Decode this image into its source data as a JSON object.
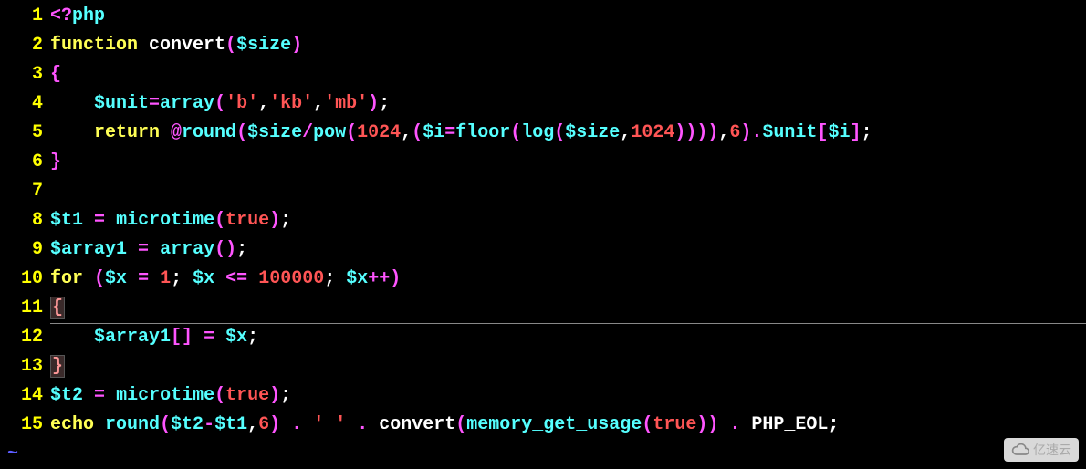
{
  "lines": [
    {
      "num": "1",
      "tokens": [
        [
          "<?",
          "op"
        ],
        [
          "php",
          "var"
        ]
      ]
    },
    {
      "num": "2",
      "tokens": [
        [
          "function ",
          "keyword"
        ],
        [
          "convert",
          "white"
        ],
        [
          "(",
          "paren"
        ],
        [
          "$size",
          "var"
        ],
        [
          ")",
          "paren"
        ]
      ]
    },
    {
      "num": "3",
      "tokens": [
        [
          "{",
          "brace"
        ]
      ]
    },
    {
      "num": "4",
      "tokens": [
        [
          "    ",
          "default"
        ],
        [
          "$unit",
          "var"
        ],
        [
          "=",
          "op"
        ],
        [
          "array",
          "func"
        ],
        [
          "(",
          "paren"
        ],
        [
          "'b'",
          "string"
        ],
        [
          ",",
          "white"
        ],
        [
          "'kb'",
          "string"
        ],
        [
          ",",
          "white"
        ],
        [
          "'mb'",
          "string"
        ],
        [
          ")",
          "paren"
        ],
        [
          ";",
          "white"
        ]
      ]
    },
    {
      "num": "5",
      "tokens": [
        [
          "    ",
          "default"
        ],
        [
          "return ",
          "keyword"
        ],
        [
          "@",
          "op"
        ],
        [
          "round",
          "func"
        ],
        [
          "(",
          "paren"
        ],
        [
          "$size",
          "var"
        ],
        [
          "/",
          "op"
        ],
        [
          "pow",
          "func"
        ],
        [
          "(",
          "paren"
        ],
        [
          "1024",
          "number"
        ],
        [
          ",",
          "white"
        ],
        [
          "(",
          "paren"
        ],
        [
          "$i",
          "var"
        ],
        [
          "=",
          "op"
        ],
        [
          "floor",
          "func"
        ],
        [
          "(",
          "paren"
        ],
        [
          "log",
          "func"
        ],
        [
          "(",
          "paren"
        ],
        [
          "$size",
          "var"
        ],
        [
          ",",
          "white"
        ],
        [
          "1024",
          "number"
        ],
        [
          "))))",
          "paren"
        ],
        [
          ",",
          "white"
        ],
        [
          "6",
          "number"
        ],
        [
          ")",
          "paren"
        ],
        [
          ".",
          "op"
        ],
        [
          "$unit",
          "var"
        ],
        [
          "[",
          "paren"
        ],
        [
          "$i",
          "var"
        ],
        [
          "]",
          "paren"
        ],
        [
          ";",
          "white"
        ]
      ]
    },
    {
      "num": "6",
      "tokens": [
        [
          "}",
          "brace"
        ]
      ]
    },
    {
      "num": "7",
      "tokens": []
    },
    {
      "num": "8",
      "tokens": [
        [
          "$t1",
          "var"
        ],
        [
          " ",
          "default"
        ],
        [
          "=",
          "op"
        ],
        [
          " ",
          "default"
        ],
        [
          "microtime",
          "func"
        ],
        [
          "(",
          "paren"
        ],
        [
          "true",
          "number"
        ],
        [
          ")",
          "paren"
        ],
        [
          ";",
          "white"
        ]
      ]
    },
    {
      "num": "9",
      "tokens": [
        [
          "$array1",
          "var"
        ],
        [
          " ",
          "default"
        ],
        [
          "=",
          "op"
        ],
        [
          " ",
          "default"
        ],
        [
          "array",
          "func"
        ],
        [
          "()",
          "paren"
        ],
        [
          ";",
          "white"
        ]
      ]
    },
    {
      "num": "10",
      "tokens": [
        [
          "for ",
          "keyword"
        ],
        [
          "(",
          "paren"
        ],
        [
          "$x",
          "var"
        ],
        [
          " ",
          "default"
        ],
        [
          "=",
          "op"
        ],
        [
          " ",
          "default"
        ],
        [
          "1",
          "number"
        ],
        [
          ";",
          "white"
        ],
        [
          " ",
          "default"
        ],
        [
          "$x",
          "var"
        ],
        [
          " ",
          "default"
        ],
        [
          "<=",
          "op"
        ],
        [
          " ",
          "default"
        ],
        [
          "100000",
          "number"
        ],
        [
          ";",
          "white"
        ],
        [
          " ",
          "default"
        ],
        [
          "$x",
          "var"
        ],
        [
          "++",
          "op"
        ],
        [
          ")",
          "paren"
        ]
      ]
    },
    {
      "num": "11",
      "tokens": [
        [
          "{",
          "hl-brace"
        ]
      ],
      "cursor": true
    },
    {
      "num": "12",
      "tokens": [
        [
          "    ",
          "default"
        ],
        [
          "$array1",
          "var"
        ],
        [
          "[]",
          "paren"
        ],
        [
          " ",
          "default"
        ],
        [
          "=",
          "op"
        ],
        [
          " ",
          "default"
        ],
        [
          "$x",
          "var"
        ],
        [
          ";",
          "white"
        ]
      ]
    },
    {
      "num": "13",
      "tokens": [
        [
          "}",
          "hl-brace"
        ]
      ]
    },
    {
      "num": "14",
      "tokens": [
        [
          "$t2",
          "var"
        ],
        [
          " ",
          "default"
        ],
        [
          "=",
          "op"
        ],
        [
          " ",
          "default"
        ],
        [
          "microtime",
          "func"
        ],
        [
          "(",
          "paren"
        ],
        [
          "true",
          "number"
        ],
        [
          ")",
          "paren"
        ],
        [
          ";",
          "white"
        ]
      ]
    },
    {
      "num": "15",
      "tokens": [
        [
          "echo ",
          "keyword"
        ],
        [
          "round",
          "func"
        ],
        [
          "(",
          "paren"
        ],
        [
          "$t2",
          "var"
        ],
        [
          "-",
          "op"
        ],
        [
          "$t1",
          "var"
        ],
        [
          ",",
          "white"
        ],
        [
          "6",
          "number"
        ],
        [
          ")",
          "paren"
        ],
        [
          " ",
          "default"
        ],
        [
          ".",
          "op"
        ],
        [
          " ",
          "default"
        ],
        [
          "' '",
          "string"
        ],
        [
          " ",
          "default"
        ],
        [
          ".",
          "op"
        ],
        [
          " ",
          "default"
        ],
        [
          "convert",
          "white"
        ],
        [
          "(",
          "paren"
        ],
        [
          "memory_get_usage",
          "func"
        ],
        [
          "(",
          "paren"
        ],
        [
          "true",
          "number"
        ],
        [
          "))",
          "paren"
        ],
        [
          " ",
          "default"
        ],
        [
          ".",
          "op"
        ],
        [
          " ",
          "default"
        ],
        [
          "PHP_EOL",
          "white"
        ],
        [
          ";",
          "white"
        ]
      ]
    }
  ],
  "tilde": "~",
  "watermark": "亿速云"
}
